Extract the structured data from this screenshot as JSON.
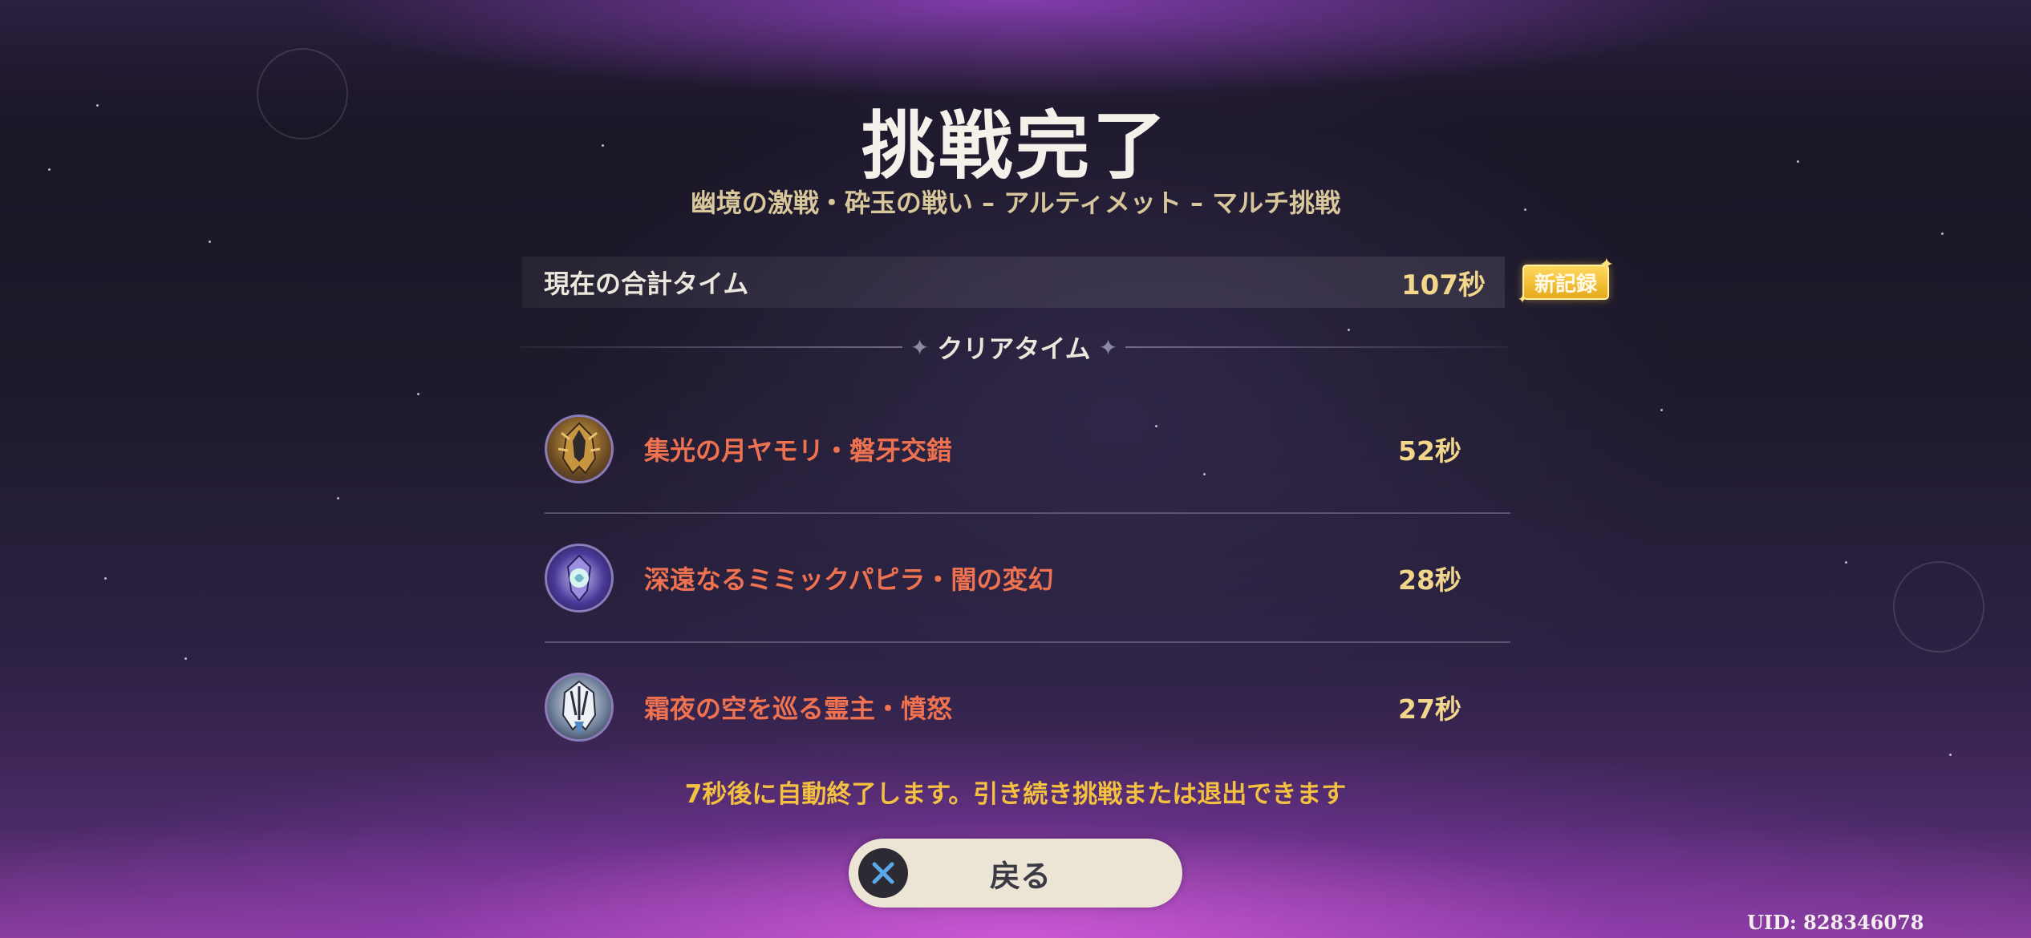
{
  "result": {
    "title": "挑戦完了",
    "subtitle": "幽境の激戦・砕玉の戦い – アルティメット – マルチ挑戦"
  },
  "total": {
    "label": "現在の合計タイム",
    "value": "107秒",
    "badge": "新記録"
  },
  "clear_times": {
    "header": "クリアタイム",
    "bosses": [
      {
        "name": "集光の月ヤモリ・磐牙交錯",
        "time": "52秒",
        "icon": "gecko-boss-icon"
      },
      {
        "name": "深遠なるミミックパピラ・闇の変幻",
        "time": "28秒",
        "icon": "papilla-boss-icon"
      },
      {
        "name": "霜夜の空を巡る霊主・憤怒",
        "time": "27秒",
        "icon": "frost-lord-boss-icon"
      }
    ]
  },
  "notice": "7秒後に自動終了します。引き続き挑戦または退出できます",
  "back_button": {
    "label": "戻る",
    "icon": "cross-button-icon"
  },
  "uid": "UID: 828346078",
  "colors": {
    "boss_name": "#ef7250",
    "time_value": "#f2d78b",
    "notice": "#f4c040",
    "badge": "#f2bf2e"
  }
}
